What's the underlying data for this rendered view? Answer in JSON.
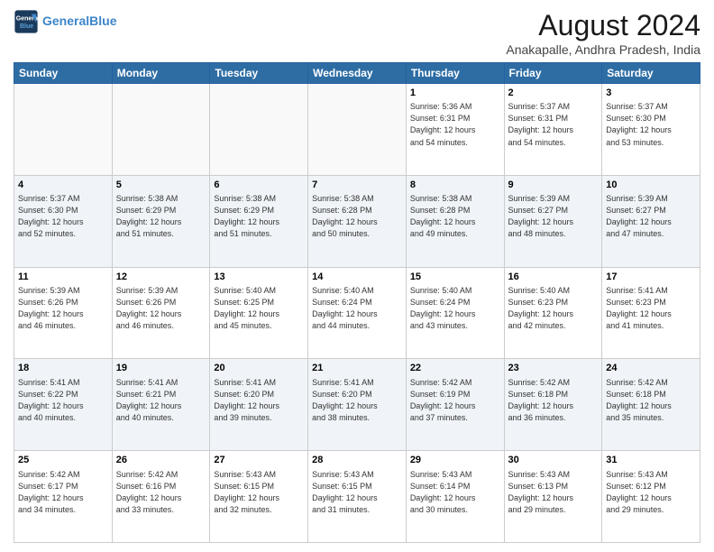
{
  "header": {
    "logo_line1": "General",
    "logo_line2": "Blue",
    "month_title": "August 2024",
    "subtitle": "Anakapalle, Andhra Pradesh, India"
  },
  "weekdays": [
    "Sunday",
    "Monday",
    "Tuesday",
    "Wednesday",
    "Thursday",
    "Friday",
    "Saturday"
  ],
  "weeks": [
    [
      {
        "day": "",
        "info": ""
      },
      {
        "day": "",
        "info": ""
      },
      {
        "day": "",
        "info": ""
      },
      {
        "day": "",
        "info": ""
      },
      {
        "day": "1",
        "info": "Sunrise: 5:36 AM\nSunset: 6:31 PM\nDaylight: 12 hours\nand 54 minutes."
      },
      {
        "day": "2",
        "info": "Sunrise: 5:37 AM\nSunset: 6:31 PM\nDaylight: 12 hours\nand 54 minutes."
      },
      {
        "day": "3",
        "info": "Sunrise: 5:37 AM\nSunset: 6:30 PM\nDaylight: 12 hours\nand 53 minutes."
      }
    ],
    [
      {
        "day": "4",
        "info": "Sunrise: 5:37 AM\nSunset: 6:30 PM\nDaylight: 12 hours\nand 52 minutes."
      },
      {
        "day": "5",
        "info": "Sunrise: 5:38 AM\nSunset: 6:29 PM\nDaylight: 12 hours\nand 51 minutes."
      },
      {
        "day": "6",
        "info": "Sunrise: 5:38 AM\nSunset: 6:29 PM\nDaylight: 12 hours\nand 51 minutes."
      },
      {
        "day": "7",
        "info": "Sunrise: 5:38 AM\nSunset: 6:28 PM\nDaylight: 12 hours\nand 50 minutes."
      },
      {
        "day": "8",
        "info": "Sunrise: 5:38 AM\nSunset: 6:28 PM\nDaylight: 12 hours\nand 49 minutes."
      },
      {
        "day": "9",
        "info": "Sunrise: 5:39 AM\nSunset: 6:27 PM\nDaylight: 12 hours\nand 48 minutes."
      },
      {
        "day": "10",
        "info": "Sunrise: 5:39 AM\nSunset: 6:27 PM\nDaylight: 12 hours\nand 47 minutes."
      }
    ],
    [
      {
        "day": "11",
        "info": "Sunrise: 5:39 AM\nSunset: 6:26 PM\nDaylight: 12 hours\nand 46 minutes."
      },
      {
        "day": "12",
        "info": "Sunrise: 5:39 AM\nSunset: 6:26 PM\nDaylight: 12 hours\nand 46 minutes."
      },
      {
        "day": "13",
        "info": "Sunrise: 5:40 AM\nSunset: 6:25 PM\nDaylight: 12 hours\nand 45 minutes."
      },
      {
        "day": "14",
        "info": "Sunrise: 5:40 AM\nSunset: 6:24 PM\nDaylight: 12 hours\nand 44 minutes."
      },
      {
        "day": "15",
        "info": "Sunrise: 5:40 AM\nSunset: 6:24 PM\nDaylight: 12 hours\nand 43 minutes."
      },
      {
        "day": "16",
        "info": "Sunrise: 5:40 AM\nSunset: 6:23 PM\nDaylight: 12 hours\nand 42 minutes."
      },
      {
        "day": "17",
        "info": "Sunrise: 5:41 AM\nSunset: 6:23 PM\nDaylight: 12 hours\nand 41 minutes."
      }
    ],
    [
      {
        "day": "18",
        "info": "Sunrise: 5:41 AM\nSunset: 6:22 PM\nDaylight: 12 hours\nand 40 minutes."
      },
      {
        "day": "19",
        "info": "Sunrise: 5:41 AM\nSunset: 6:21 PM\nDaylight: 12 hours\nand 40 minutes."
      },
      {
        "day": "20",
        "info": "Sunrise: 5:41 AM\nSunset: 6:20 PM\nDaylight: 12 hours\nand 39 minutes."
      },
      {
        "day": "21",
        "info": "Sunrise: 5:41 AM\nSunset: 6:20 PM\nDaylight: 12 hours\nand 38 minutes."
      },
      {
        "day": "22",
        "info": "Sunrise: 5:42 AM\nSunset: 6:19 PM\nDaylight: 12 hours\nand 37 minutes."
      },
      {
        "day": "23",
        "info": "Sunrise: 5:42 AM\nSunset: 6:18 PM\nDaylight: 12 hours\nand 36 minutes."
      },
      {
        "day": "24",
        "info": "Sunrise: 5:42 AM\nSunset: 6:18 PM\nDaylight: 12 hours\nand 35 minutes."
      }
    ],
    [
      {
        "day": "25",
        "info": "Sunrise: 5:42 AM\nSunset: 6:17 PM\nDaylight: 12 hours\nand 34 minutes."
      },
      {
        "day": "26",
        "info": "Sunrise: 5:42 AM\nSunset: 6:16 PM\nDaylight: 12 hours\nand 33 minutes."
      },
      {
        "day": "27",
        "info": "Sunrise: 5:43 AM\nSunset: 6:15 PM\nDaylight: 12 hours\nand 32 minutes."
      },
      {
        "day": "28",
        "info": "Sunrise: 5:43 AM\nSunset: 6:15 PM\nDaylight: 12 hours\nand 31 minutes."
      },
      {
        "day": "29",
        "info": "Sunrise: 5:43 AM\nSunset: 6:14 PM\nDaylight: 12 hours\nand 30 minutes."
      },
      {
        "day": "30",
        "info": "Sunrise: 5:43 AM\nSunset: 6:13 PM\nDaylight: 12 hours\nand 29 minutes."
      },
      {
        "day": "31",
        "info": "Sunrise: 5:43 AM\nSunset: 6:12 PM\nDaylight: 12 hours\nand 29 minutes."
      }
    ]
  ]
}
